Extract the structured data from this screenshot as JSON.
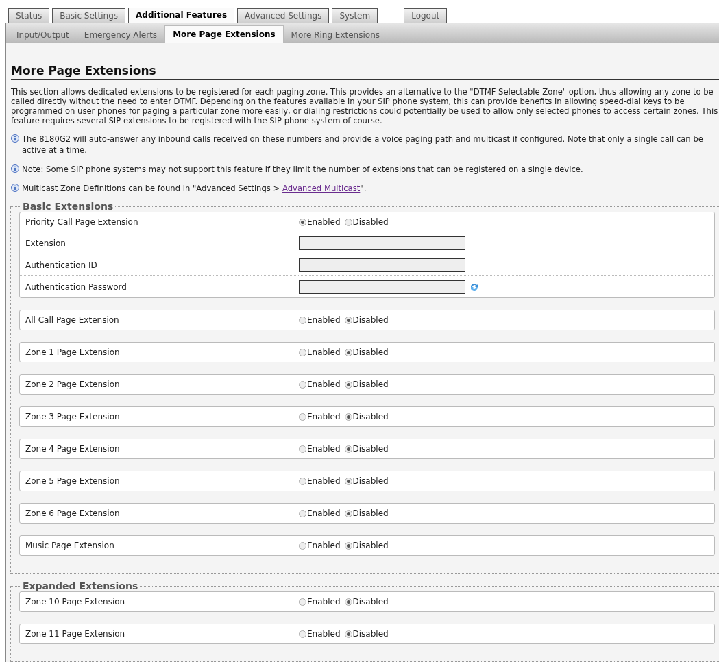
{
  "tabs": [
    {
      "label": "Status",
      "selected": false
    },
    {
      "label": "Basic Settings",
      "selected": false
    },
    {
      "label": "Additional Features",
      "selected": true
    },
    {
      "label": "Advanced Settings",
      "selected": false
    },
    {
      "label": "System",
      "selected": false
    },
    {
      "label": "Logout",
      "selected": false,
      "kind": "right"
    }
  ],
  "subtabs": [
    {
      "label": "Input/Output",
      "selected": false
    },
    {
      "label": "Emergency Alerts",
      "selected": false
    },
    {
      "label": "More Page Extensions",
      "selected": true
    },
    {
      "label": "More Ring Extensions",
      "selected": false
    }
  ],
  "title": "More Page Extensions",
  "intro": "This section allows dedicated extensions to be registered for each paging zone. This provides an alternative to the \"DTMF Selectable Zone\" option, thus allowing any zone to be called directly without the need to enter DTMF. Depending on the features available in your SIP phone system, this can provide benefits in allowing speed-dial keys to be programmed on user phones for paging a particular zone more easily, or dialing restrictions could potentially be used to allow only selected phones to access certain zones. This feature requires several SIP extensions to be registered with the SIP phone system of course.",
  "notes": [
    {
      "text": "The 8180G2 will auto-answer any inbound calls received on these numbers and provide a voice paging path and multicast if configured. Note that only a single call can be active at a time."
    },
    {
      "text": "Note: Some SIP phone systems may not support this feature if they limit the number of extensions that can be registered on a single device."
    },
    {
      "text": "Multicast Zone Definitions can be found in \"Advanced Settings > ",
      "link": "Advanced Multicast",
      "after": "\"."
    }
  ],
  "groups": [
    {
      "legend": "Basic Extensions",
      "panels": [
        {
          "rows": [
            {
              "kind": "radio",
              "label": "Priority Call Page Extension",
              "options": [
                {
                  "label": "Enabled",
                  "selected": true
                },
                {
                  "label": "Disabled",
                  "selected": false
                }
              ]
            },
            {
              "kind": "field",
              "label": "Extension"
            },
            {
              "kind": "field",
              "label": "Authentication ID"
            },
            {
              "kind": "field",
              "label": "Authentication Password",
              "refresh": true
            }
          ]
        },
        {
          "rows": [
            {
              "kind": "radio",
              "label": "All Call Page Extension",
              "options": [
                {
                  "label": "Enabled",
                  "selected": false
                },
                {
                  "label": "Disabled",
                  "selected": true
                }
              ]
            }
          ]
        },
        {
          "rows": [
            {
              "kind": "radio",
              "label": "Zone 1 Page Extension",
              "options": [
                {
                  "label": "Enabled",
                  "selected": false
                },
                {
                  "label": "Disabled",
                  "selected": true
                }
              ]
            }
          ]
        },
        {
          "rows": [
            {
              "kind": "radio",
              "label": "Zone 2 Page Extension",
              "options": [
                {
                  "label": "Enabled",
                  "selected": false
                },
                {
                  "label": "Disabled",
                  "selected": true
                }
              ]
            }
          ]
        },
        {
          "rows": [
            {
              "kind": "radio",
              "label": "Zone 3 Page Extension",
              "options": [
                {
                  "label": "Enabled",
                  "selected": false
                },
                {
                  "label": "Disabled",
                  "selected": true
                }
              ]
            }
          ]
        },
        {
          "rows": [
            {
              "kind": "radio",
              "label": "Zone 4 Page Extension",
              "options": [
                {
                  "label": "Enabled",
                  "selected": false
                },
                {
                  "label": "Disabled",
                  "selected": true
                }
              ]
            }
          ]
        },
        {
          "rows": [
            {
              "kind": "radio",
              "label": "Zone 5 Page Extension",
              "options": [
                {
                  "label": "Enabled",
                  "selected": false
                },
                {
                  "label": "Disabled",
                  "selected": true
                }
              ]
            }
          ]
        },
        {
          "rows": [
            {
              "kind": "radio",
              "label": "Zone 6 Page Extension",
              "options": [
                {
                  "label": "Enabled",
                  "selected": false
                },
                {
                  "label": "Disabled",
                  "selected": true
                }
              ]
            }
          ]
        },
        {
          "rows": [
            {
              "kind": "radio",
              "label": "Music Page Extension",
              "options": [
                {
                  "label": "Enabled",
                  "selected": false
                },
                {
                  "label": "Disabled",
                  "selected": true
                }
              ]
            }
          ]
        }
      ]
    },
    {
      "legend": "Expanded Extensions",
      "panels": [
        {
          "rows": [
            {
              "kind": "radio",
              "label": "Zone 10 Page Extension",
              "options": [
                {
                  "label": "Enabled",
                  "selected": false
                },
                {
                  "label": "Disabled",
                  "selected": true
                }
              ]
            }
          ]
        },
        {
          "rows": [
            {
              "kind": "radio",
              "label": "Zone 11 Page Extension",
              "options": [
                {
                  "label": "Enabled",
                  "selected": false
                },
                {
                  "label": "Disabled",
                  "selected": true
                }
              ]
            }
          ]
        }
      ]
    }
  ]
}
